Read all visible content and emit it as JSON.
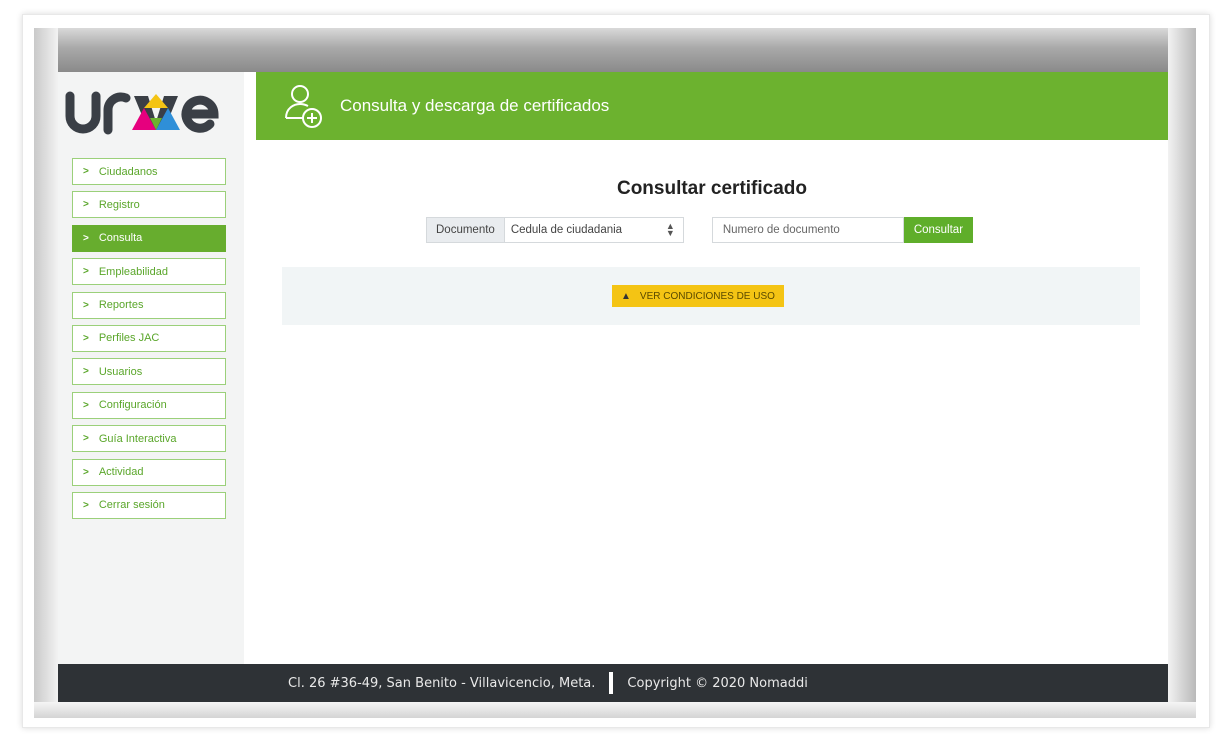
{
  "app": {
    "logo_text": "urve"
  },
  "sidebar": {
    "items": [
      {
        "label": "Ciudadanos",
        "active": false
      },
      {
        "label": "Registro",
        "active": false
      },
      {
        "label": "Consulta",
        "active": true
      },
      {
        "label": "Empleabilidad",
        "active": false
      },
      {
        "label": "Reportes",
        "active": false
      },
      {
        "label": "Perfiles JAC",
        "active": false
      },
      {
        "label": "Usuarios",
        "active": false
      },
      {
        "label": "Configuración",
        "active": false
      },
      {
        "label": "Guía Interactiva",
        "active": false
      },
      {
        "label": "Actividad",
        "active": false
      },
      {
        "label": "Cerrar sesión",
        "active": false
      }
    ],
    "chevron": ">"
  },
  "header": {
    "title": "Consulta y descarga de certificados",
    "icon": "add-user-icon"
  },
  "main": {
    "title": "Consultar certificado",
    "form": {
      "document_label": "Documento",
      "document_type_value": "Cedula de ciudadania",
      "document_number_placeholder": "Numero de documento",
      "submit_label": "Consultar"
    },
    "notice": {
      "button_label": "VER CONDICIONES DE USO",
      "icon": "warning-icon"
    }
  },
  "footer": {
    "address": "Cl. 26 #36-49, San Benito - Villavicencio, Meta.",
    "copyright": "Copyright © 2020 Nomaddi"
  },
  "colors": {
    "brand_green": "#6cb22f",
    "active_nav": "#67ad2e",
    "warning": "#f4c414",
    "footer_bg": "#2e3236"
  }
}
